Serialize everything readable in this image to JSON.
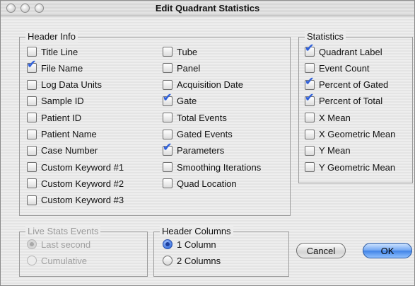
{
  "window": {
    "title": "Edit Quadrant Statistics"
  },
  "header_info": {
    "title": "Header Info",
    "col1": [
      {
        "label": "Title Line",
        "checked": false
      },
      {
        "label": "File Name",
        "checked": true
      },
      {
        "label": "Log Data Units",
        "checked": false
      },
      {
        "label": "Sample ID",
        "checked": false
      },
      {
        "label": "Patient ID",
        "checked": false
      },
      {
        "label": "Patient Name",
        "checked": false
      },
      {
        "label": "Case Number",
        "checked": false
      },
      {
        "label": "Custom Keyword #1",
        "checked": false
      },
      {
        "label": "Custom Keyword #2",
        "checked": false
      },
      {
        "label": "Custom Keyword #3",
        "checked": false
      }
    ],
    "col2": [
      {
        "label": "Tube",
        "checked": false
      },
      {
        "label": "Panel",
        "checked": false
      },
      {
        "label": "Acquisition Date",
        "checked": false
      },
      {
        "label": "Gate",
        "checked": true
      },
      {
        "label": "Total Events",
        "checked": false
      },
      {
        "label": "Gated Events",
        "checked": false
      },
      {
        "label": "Parameters",
        "checked": true
      },
      {
        "label": "Smoothing Iterations",
        "checked": false
      },
      {
        "label": "Quad Location",
        "checked": false
      }
    ]
  },
  "statistics": {
    "title": "Statistics",
    "items": [
      {
        "label": "Quadrant Label",
        "checked": true
      },
      {
        "label": "Event Count",
        "checked": false
      },
      {
        "label": "Percent of Gated",
        "checked": true
      },
      {
        "label": "Percent of Total",
        "checked": true
      },
      {
        "label": "X Mean",
        "checked": false
      },
      {
        "label": "X Geometric Mean",
        "checked": false
      },
      {
        "label": "Y Mean",
        "checked": false
      },
      {
        "label": "Y Geometric Mean",
        "checked": false
      }
    ]
  },
  "live_stats": {
    "title": "Live Stats Events",
    "options": [
      {
        "label": "Last second",
        "selected": true
      },
      {
        "label": "Cumulative",
        "selected": false
      }
    ]
  },
  "header_columns": {
    "title": "Header Columns",
    "options": [
      {
        "label": "1 Column",
        "selected": true
      },
      {
        "label": "2 Columns",
        "selected": false
      }
    ]
  },
  "buttons": {
    "cancel": "Cancel",
    "ok": "OK"
  }
}
